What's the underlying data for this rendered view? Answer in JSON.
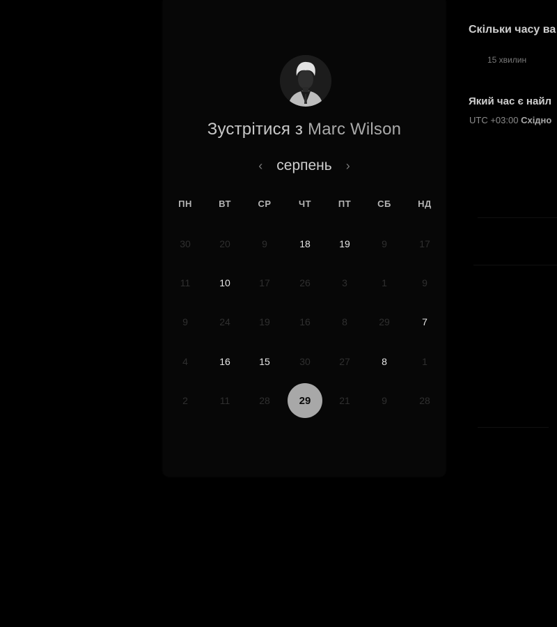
{
  "profile": {
    "title_prefix": "Зустрітися з",
    "name": "Marc Wilson"
  },
  "calendar": {
    "month": "серпень",
    "prev_icon": "‹",
    "next_icon": "›",
    "weekdays": [
      "ПН",
      "ВТ",
      "СР",
      "ЧТ",
      "ПТ",
      "СБ",
      "НД"
    ],
    "rows": [
      [
        {
          "t": "30",
          "s": "off"
        },
        {
          "t": "20",
          "s": "off"
        },
        {
          "t": "9",
          "s": "off"
        },
        {
          "t": "18",
          "s": "on"
        },
        {
          "t": "19",
          "s": "on"
        },
        {
          "t": "9",
          "s": "off"
        },
        {
          "t": "17",
          "s": "off"
        }
      ],
      [
        {
          "t": "11",
          "s": "off"
        },
        {
          "t": "10",
          "s": "on"
        },
        {
          "t": "17",
          "s": "off"
        },
        {
          "t": "26",
          "s": "off"
        },
        {
          "t": "3",
          "s": "off"
        },
        {
          "t": "1",
          "s": "off"
        },
        {
          "t": "9",
          "s": "off"
        }
      ],
      [
        {
          "t": "9",
          "s": "off"
        },
        {
          "t": "24",
          "s": "off"
        },
        {
          "t": "19",
          "s": "off"
        },
        {
          "t": "16",
          "s": "off"
        },
        {
          "t": "8",
          "s": "off"
        },
        {
          "t": "29",
          "s": "off"
        },
        {
          "t": "7",
          "s": "on"
        }
      ],
      [
        {
          "t": "4",
          "s": "off"
        },
        {
          "t": "16",
          "s": "on"
        },
        {
          "t": "15",
          "s": "on"
        },
        {
          "t": "30",
          "s": "off"
        },
        {
          "t": "27",
          "s": "off"
        },
        {
          "t": "8",
          "s": "on"
        },
        {
          "t": "1",
          "s": "off"
        }
      ],
      [
        {
          "t": "2",
          "s": "off"
        },
        {
          "t": "11",
          "s": "off"
        },
        {
          "t": "28",
          "s": "off"
        },
        {
          "t": "29",
          "s": "sel"
        },
        {
          "t": "21",
          "s": "off"
        },
        {
          "t": "9",
          "s": "off"
        },
        {
          "t": "28",
          "s": "off"
        }
      ]
    ]
  },
  "side": {
    "duration_question": "Скільки часу ва",
    "duration_option": "15 хвилин",
    "time_question": "Який час є найл",
    "timezone_offset": "UTC +03:00",
    "timezone_name": "Східно"
  }
}
